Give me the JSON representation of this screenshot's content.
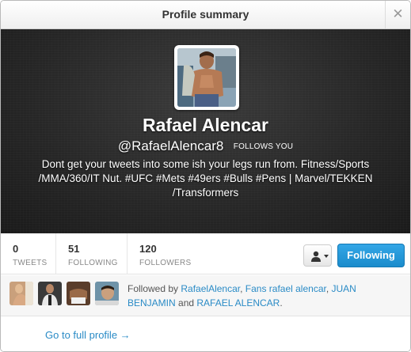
{
  "dialog": {
    "title": "Profile summary",
    "close_glyph": "✕"
  },
  "profile": {
    "name": "Rafael Alencar",
    "handle": "@RafaelAlencar8",
    "follows_you": "FOLLOWS YOU",
    "bio": "Dont get your tweets into some ish your legs run from. Fitness/Sports /MMA/360/IT Nut. #UFC #Mets #49ers #Bulls #Pens | Marvel/TEKKEN /Transformers"
  },
  "stats": {
    "tweets": {
      "value": "0",
      "label": "TWEETS"
    },
    "following": {
      "value": "51",
      "label": "FOLLOWING"
    },
    "followers": {
      "value": "120",
      "label": "FOLLOWERS"
    }
  },
  "actions": {
    "user_dropdown_icon": "person-icon",
    "follow_button": "Following"
  },
  "followed_by": {
    "prefix": "Followed by ",
    "users": [
      "RafaelAlencar",
      "Fans rafael alencar",
      "JUAN BENJAMIN",
      "RAFAEL ALENCAR"
    ],
    "sep1": ", ",
    "sep2": ", ",
    "and": " and ",
    "suffix": "."
  },
  "footer": {
    "full_profile_link": "Go to full profile →"
  },
  "colors": {
    "accent": "#2a8bc6",
    "button": "#1b8ccc",
    "header_bg": "#262626"
  }
}
